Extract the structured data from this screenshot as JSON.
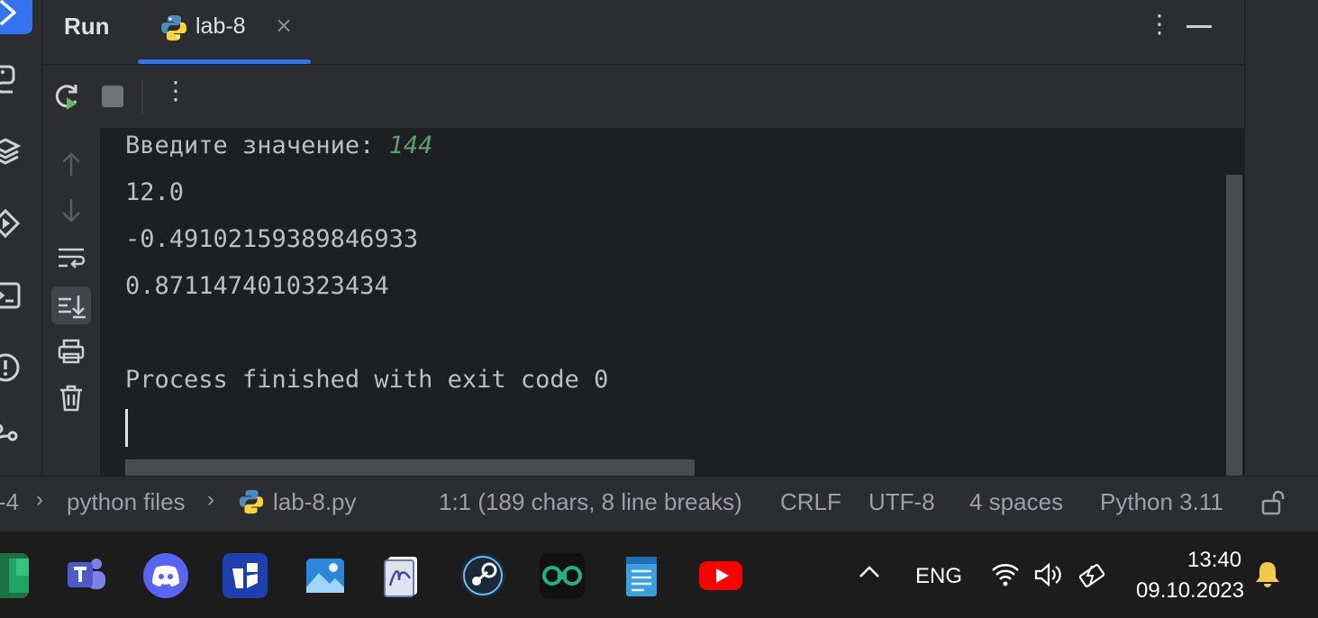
{
  "run_window": {
    "title": "Run",
    "tab": {
      "label": "lab-8",
      "close": "×"
    },
    "more": "⋮"
  },
  "toolbar": {
    "more": "⋮"
  },
  "console": {
    "prompt": "Введите значение: ",
    "input_value": "144",
    "lines": [
      "12.0",
      "-0.49102159389846933",
      "0.8711474010323434"
    ],
    "exit_message": "Process finished with exit code 0"
  },
  "statusbar": {
    "project_fragment": "-4",
    "folder": "python files",
    "file": "lab-8.py",
    "position": "1:1 (189 chars, 8 line breaks)",
    "line_ending": "CRLF",
    "encoding": "UTF-8",
    "indent": "4 spaces",
    "interpreter": "Python 3.11"
  },
  "taskbar": {
    "language": "ENG",
    "time": "13:40",
    "date": "09.10.2023"
  },
  "colors": {
    "accent": "#3574f0",
    "input_green": "#5c9e6e",
    "console_bg": "#1e1f22",
    "panel_bg": "#2b2d30"
  }
}
